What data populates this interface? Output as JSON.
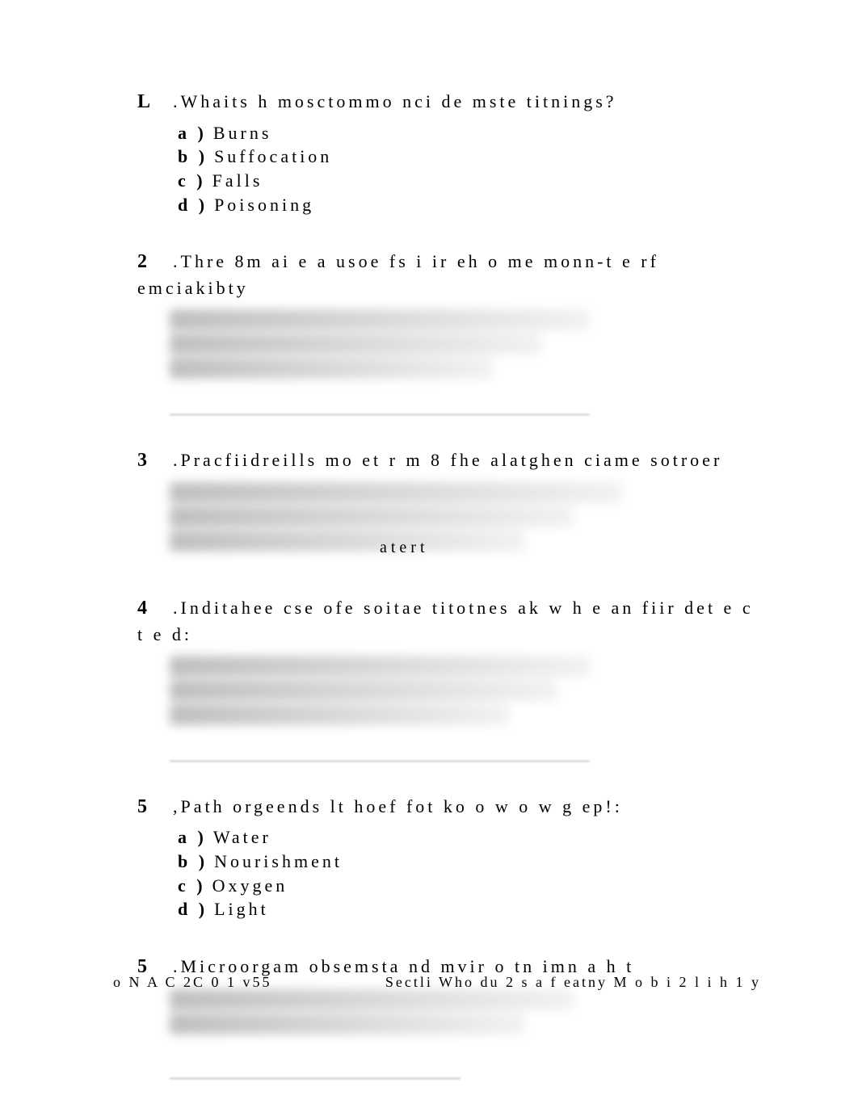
{
  "questions": [
    {
      "num": "L",
      "text": ".Whaits h mosctommo nci de mste titnings?",
      "options": [
        {
          "letter": "a )",
          "label": "Burns"
        },
        {
          "letter": "b )",
          "label": "Suffocation"
        },
        {
          "letter": "c )",
          "label": "Falls"
        },
        {
          "letter": "d )",
          "label": "Poisoning"
        }
      ]
    },
    {
      "num": "2",
      "text": ".Thre 8m ai e a usoe fs i ir eh o me monn-t e rf emciakibty"
    },
    {
      "num": "3",
      "text": ".Pracfiidreills   mo et   r m 8 fhe alatghen ciame sotroer",
      "center": "atert"
    },
    {
      "num": "4",
      "text": ".Inditahee cse ofe soitae titotnes ak w h e an fiir det e c t e d:"
    },
    {
      "num": "5",
      "text": ",Path orgeends lt hoef  fot ko o w o w g ep!:",
      "options": [
        {
          "letter": "a )",
          "label": "Water"
        },
        {
          "letter": "b )",
          "label": "Nourishment"
        },
        {
          "letter": "c )",
          "label": "Oxygen"
        },
        {
          "letter": "d )",
          "label": "Light"
        }
      ]
    },
    {
      "num": "5",
      "text": ".Microorgam obsemsta nd mvir o tn imn a h t"
    }
  ],
  "footer": {
    "left": "o N A C 2C 0 1 v55",
    "right": "Sectli Who du 2 s a f eatny M o b i 2 l i h 1 y"
  }
}
